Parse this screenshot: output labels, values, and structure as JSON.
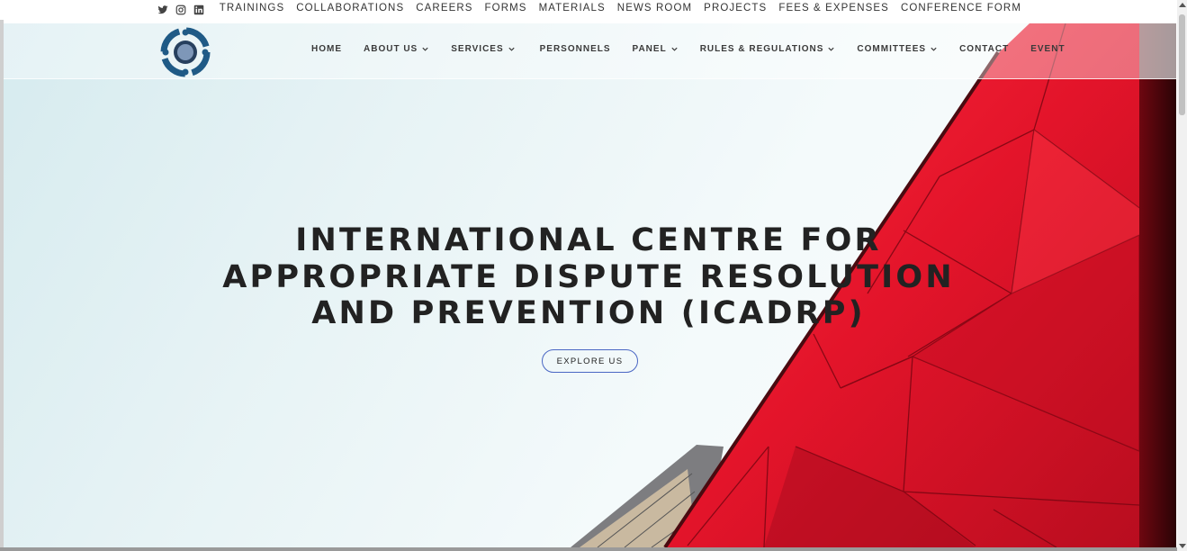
{
  "social": {
    "icons": [
      "twitter-icon",
      "instagram-icon",
      "linkedin-icon"
    ]
  },
  "utility_nav": {
    "items": [
      {
        "label": "TRAININGS"
      },
      {
        "label": "COLLABORATIONS"
      },
      {
        "label": "CAREERS"
      },
      {
        "label": "FORMS"
      },
      {
        "label": "MATERIALS"
      },
      {
        "label": "NEWS ROOM"
      },
      {
        "label": "PROJECTS"
      },
      {
        "label": "FEES & EXPENSES"
      },
      {
        "label": "CONFERENCE FORM"
      }
    ]
  },
  "main_nav": {
    "items": [
      {
        "label": "HOME",
        "has_dropdown": false
      },
      {
        "label": "ABOUT US",
        "has_dropdown": true
      },
      {
        "label": "SERVICES",
        "has_dropdown": true
      },
      {
        "label": "PERSONNELS",
        "has_dropdown": false
      },
      {
        "label": "PANEL",
        "has_dropdown": true
      },
      {
        "label": "RULES & REGULATIONS",
        "has_dropdown": true
      },
      {
        "label": "COMMITTEES",
        "has_dropdown": true
      },
      {
        "label": "CONTACT",
        "has_dropdown": false
      },
      {
        "label": "EVENT",
        "has_dropdown": false
      }
    ]
  },
  "hero": {
    "headline_lines": [
      "INTERNATIONAL CENTRE FOR",
      "APPROPRIATE DISPUTE RESOLUTION",
      "AND PREVENTION (ICADRP)"
    ],
    "cta_label": "EXPLORE US"
  },
  "colors": {
    "accent_red": "#e0162b",
    "button_border": "#4a67c4",
    "text_dark": "#222222",
    "logo_blue": "#1f5a86"
  }
}
